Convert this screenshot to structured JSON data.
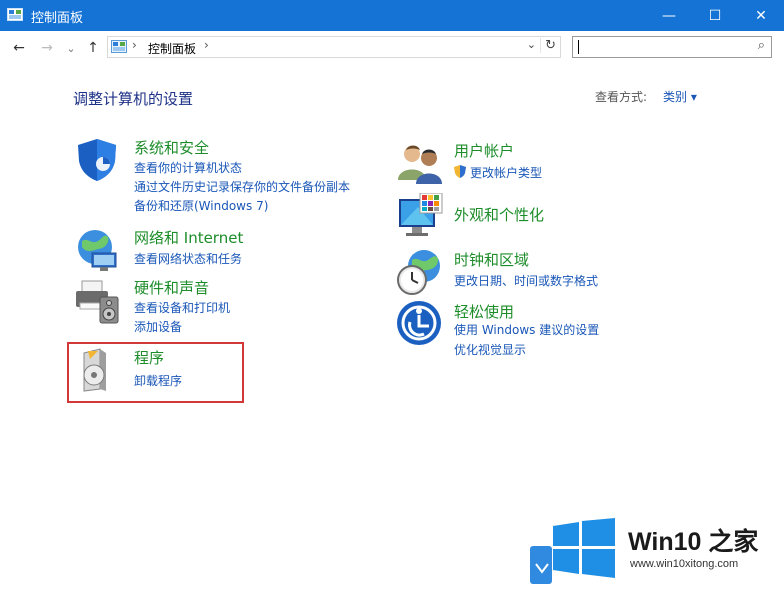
{
  "window": {
    "title": "控制面板",
    "minimize_glyph": "—",
    "maximize_glyph": "☐",
    "close_glyph": "✕"
  },
  "toolbar": {
    "back_glyph": "←",
    "forward_glyph": "→",
    "recent_glyph": "⌄",
    "up_glyph": "↑",
    "breadcrumb_sep": "›",
    "breadcrumb": "控制面板",
    "address_dropdown": "⌄",
    "refresh_glyph": "↻",
    "search_value": "",
    "search_icon_glyph": "⌕"
  },
  "main": {
    "heading": "调整计算机的设置",
    "view_label": "查看方式:",
    "view_value": "类别 ▾"
  },
  "left_categories": [
    {
      "title": "系统和安全",
      "icon": "shield-icon",
      "links": [
        "查看你的计算机状态",
        "通过文件历史记录保存你的文件备份副本",
        "备份和还原(Windows 7)"
      ]
    },
    {
      "title": "网络和 Internet",
      "icon": "network-globe-icon",
      "links": [
        "查看网络状态和任务"
      ]
    },
    {
      "title": "硬件和声音",
      "icon": "printer-icon",
      "links": [
        "查看设备和打印机",
        "添加设备"
      ]
    },
    {
      "title": "程序",
      "icon": "programs-disc-icon",
      "links": [
        "卸载程序"
      ]
    }
  ],
  "right_categories": [
    {
      "title": "用户帐户",
      "icon": "users-icon",
      "links": [
        "更改帐户类型"
      ]
    },
    {
      "title": "外观和个性化",
      "icon": "monitor-palette-icon",
      "links": []
    },
    {
      "title": "时钟和区域",
      "icon": "clock-globe-icon",
      "links": [
        "更改日期、时间或数字格式"
      ]
    },
    {
      "title": "轻松使用",
      "icon": "ease-of-access-icon",
      "links": [
        "使用 Windows 建议的设置",
        "优化视觉显示"
      ]
    }
  ],
  "watermark": {
    "brand": "Win10 之家",
    "url": "www.win10xitong.com"
  },
  "colors": {
    "titlebar": "#1673d6",
    "category_title": "#1d8d2a",
    "link": "#1a57b7",
    "highlight_border": "#d33838"
  }
}
